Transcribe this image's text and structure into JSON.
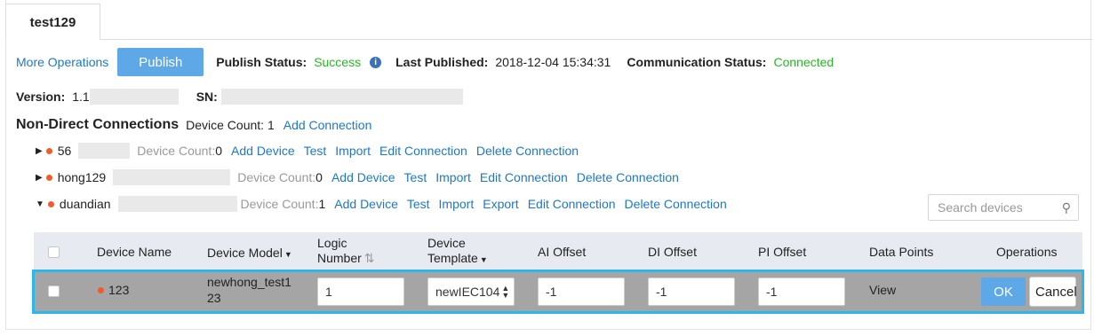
{
  "tab": {
    "label": "test129"
  },
  "toolbar": {
    "more_operations": "More Operations",
    "publish": "Publish",
    "publish_status_label": "Publish Status:",
    "publish_status_value": "Success",
    "last_published_label": "Last Published:",
    "last_published_value": "2018-12-04 15:34:31",
    "communication_status_label": "Communication Status:",
    "communication_status_value": "Connected"
  },
  "meta": {
    "version_label": "Version:",
    "version_value": "1.1",
    "sn_label": "SN:"
  },
  "section": {
    "title": "Non-Direct Connections",
    "device_count": "Device Count: 1",
    "add_connection": "Add Connection"
  },
  "connections": [
    {
      "name": "56",
      "device_count_label": "Device Count:",
      "device_count_value": "0",
      "actions": [
        "Add Device",
        "Test",
        "Import",
        "Edit Connection",
        "Delete Connection"
      ]
    },
    {
      "name": "hong129",
      "device_count_label": "Device Count:",
      "device_count_value": "0",
      "actions": [
        "Add Device",
        "Test",
        "Import",
        "Edit Connection",
        "Delete Connection"
      ]
    },
    {
      "name": "duandian",
      "device_count_label": "Device Count:",
      "device_count_value": "1",
      "actions": [
        "Add Device",
        "Test",
        "Import",
        "Export",
        "Edit Connection",
        "Delete Connection"
      ]
    }
  ],
  "search": {
    "placeholder": "Search devices"
  },
  "table": {
    "headers": {
      "device_name": "Device Name",
      "device_model": "Device Model",
      "logic_number_1": "Logic",
      "logic_number_2": "Number",
      "device_template_1": "Device",
      "device_template_2": "Template",
      "ai_offset": "AI Offset",
      "di_offset": "DI Offset",
      "pi_offset": "PI Offset",
      "data_points": "Data Points",
      "operations": "Operations"
    },
    "row": {
      "device_name": "123",
      "device_model_1": "newhong_test1",
      "device_model_2": "23",
      "logic_number": "1",
      "device_template": "newIEC104",
      "ai_offset": "-1",
      "di_offset": "-1",
      "pi_offset": "-1",
      "data_points": "View",
      "ok": "OK",
      "cancel": "Cancel"
    }
  },
  "colors": {
    "accent": "#1f78c1",
    "success": "#27b627",
    "button": "#5fa8e8",
    "status_dot": "#ef5b2f",
    "selection": "#2bb8e8"
  }
}
